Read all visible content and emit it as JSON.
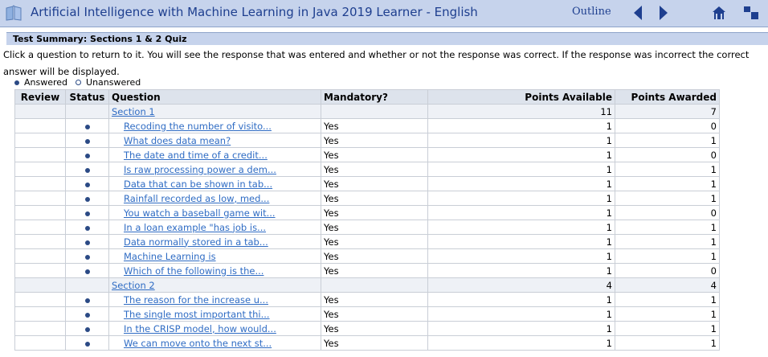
{
  "header": {
    "title": "Artificial Intelligence with Machine Learning in Java 2019 Learner - English",
    "outline_label": "Outline",
    "icons": [
      "book-icon",
      "arrow-left-icon",
      "arrow-right-icon",
      "home-icon",
      "menu-icon"
    ]
  },
  "summary": {
    "title": "Test Summary: Sections 1 & 2 Quiz",
    "instructions": "Click a question to return to it. You will see the response that was entered and whether or not the response was correct. If the response was incorrect the correct answer will be displayed."
  },
  "legend": {
    "answered": "Answered",
    "unanswered": "Unanswered"
  },
  "table": {
    "headers": {
      "review": "Review",
      "status": "Status",
      "question": "Question",
      "mandatory": "Mandatory?",
      "available": "Points Available",
      "awarded": "Points Awarded"
    },
    "sections": [
      {
        "name": "Section 1",
        "available": "11",
        "awarded": "7",
        "questions": [
          {
            "text": "Recoding the number of visito...",
            "mandatory": "Yes",
            "available": "1",
            "awarded": "0"
          },
          {
            "text": "What does data mean?",
            "mandatory": "Yes",
            "available": "1",
            "awarded": "1"
          },
          {
            "text": "The date and time of a credit...",
            "mandatory": "Yes",
            "available": "1",
            "awarded": "0"
          },
          {
            "text": "Is raw processing power a dem...",
            "mandatory": "Yes",
            "available": "1",
            "awarded": "1"
          },
          {
            "text": "Data that can be shown in tab...",
            "mandatory": "Yes",
            "available": "1",
            "awarded": "1"
          },
          {
            "text": "Rainfall recorded as low, med...",
            "mandatory": "Yes",
            "available": "1",
            "awarded": "1"
          },
          {
            "text": "You watch a baseball game wit...",
            "mandatory": "Yes",
            "available": "1",
            "awarded": "0"
          },
          {
            "text": "In a loan example \"has job is...",
            "mandatory": "Yes",
            "available": "1",
            "awarded": "1"
          },
          {
            "text": "Data normally stored in a tab...",
            "mandatory": "Yes",
            "available": "1",
            "awarded": "1"
          },
          {
            "text": "Machine Learning is",
            "mandatory": "Yes",
            "available": "1",
            "awarded": "1"
          },
          {
            "text": "Which of the following is the...",
            "mandatory": "Yes",
            "available": "1",
            "awarded": "0"
          }
        ]
      },
      {
        "name": "Section 2",
        "available": "4",
        "awarded": "4",
        "questions": [
          {
            "text": "The reason for the increase u...",
            "mandatory": "Yes",
            "available": "1",
            "awarded": "1"
          },
          {
            "text": "The single most important thi...",
            "mandatory": "Yes",
            "available": "1",
            "awarded": "1"
          },
          {
            "text": "In the CRISP model, how would...",
            "mandatory": "Yes",
            "available": "1",
            "awarded": "1"
          },
          {
            "text": "We can move onto the next st...",
            "mandatory": "Yes",
            "available": "1",
            "awarded": "1"
          }
        ]
      }
    ]
  },
  "colors": {
    "header_bg": "#c6d3ec",
    "title_text": "#1e3f8f",
    "link": "#2f6cc4",
    "dot": "#2b4a85"
  }
}
